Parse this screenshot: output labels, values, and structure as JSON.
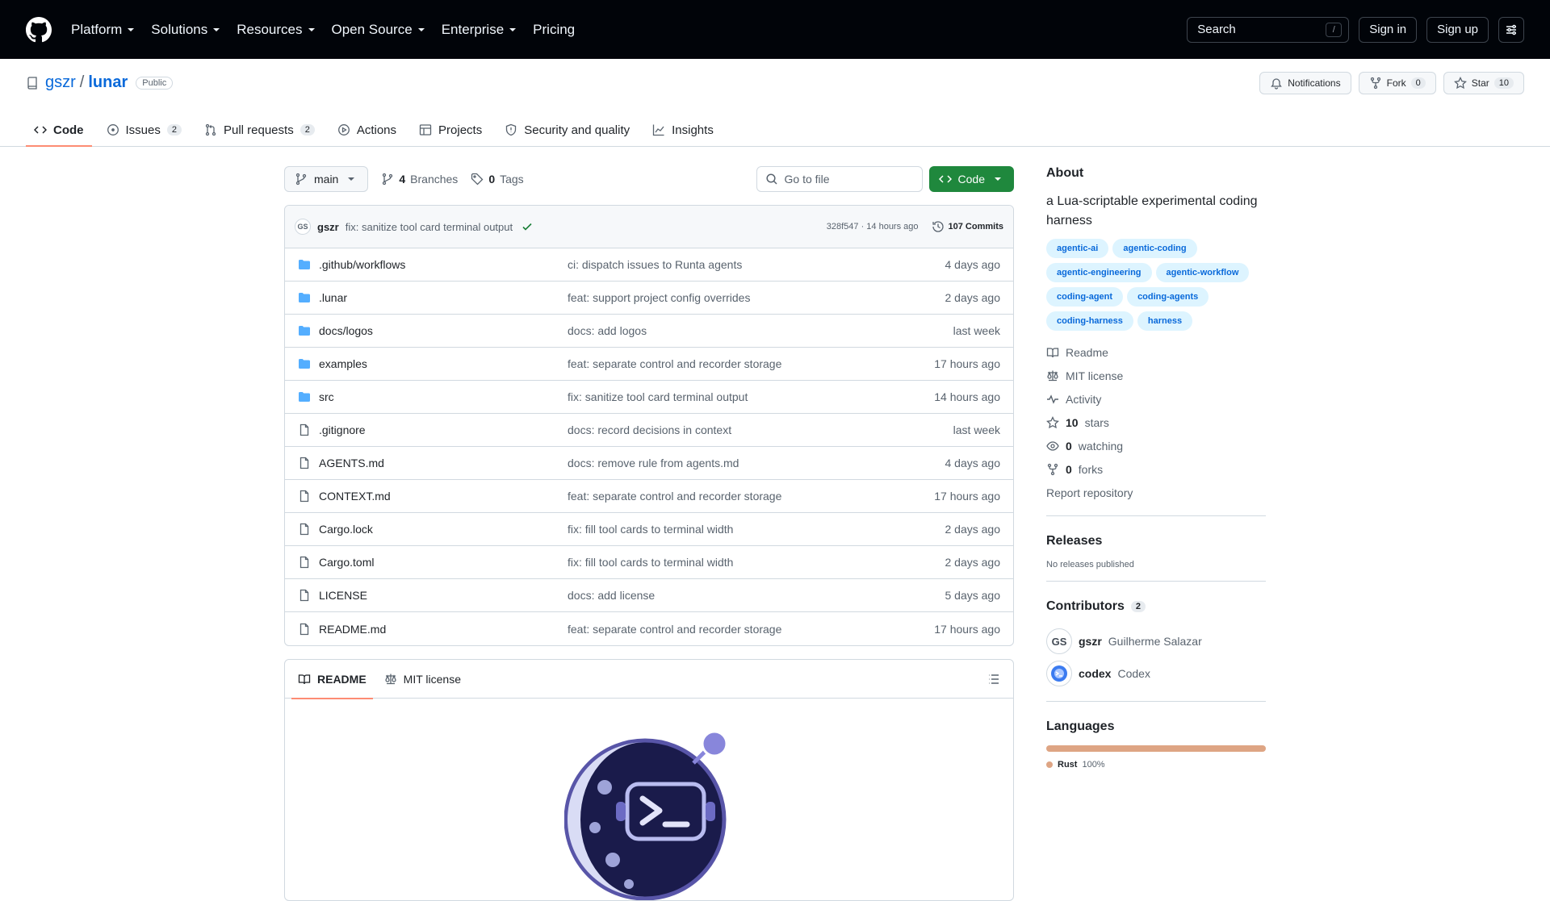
{
  "header": {
    "nav": [
      "Platform",
      "Solutions",
      "Resources",
      "Open Source",
      "Enterprise",
      "Pricing"
    ],
    "search_label": "Search",
    "search_key": "/",
    "signin": "Sign in",
    "signup": "Sign up"
  },
  "repo": {
    "owner": "gszr",
    "separator": "/",
    "name": "lunar",
    "visibility": "Public",
    "notifications": "Notifications",
    "fork_label": "Fork",
    "fork_count": "0",
    "star_label": "Star",
    "star_count": "10"
  },
  "tabs": [
    {
      "label": "Code"
    },
    {
      "label": "Issues",
      "count": "2"
    },
    {
      "label": "Pull requests",
      "count": "2"
    },
    {
      "label": "Actions"
    },
    {
      "label": "Projects"
    },
    {
      "label": "Security and quality"
    },
    {
      "label": "Insights"
    }
  ],
  "toolbar": {
    "branch": "main",
    "branches_count": "4",
    "branches_label": "Branches",
    "tags_count": "0",
    "tags_label": "Tags",
    "goto_placeholder": "Go to file",
    "code_btn": "Code"
  },
  "latest_commit": {
    "avatar_initials": "GS",
    "author": "gszr",
    "message": "fix: sanitize tool card terminal output",
    "sha_time": "328f547 · 14 hours ago",
    "commits": "107 Commits"
  },
  "files": [
    {
      "type": "dir",
      "name": ".github/workflows",
      "message": "ci: dispatch issues to Runta agents",
      "date": "4 days ago"
    },
    {
      "type": "dir",
      "name": ".lunar",
      "message": "feat: support project config overrides",
      "date": "2 days ago"
    },
    {
      "type": "dir",
      "name": "docs/logos",
      "message": "docs: add logos",
      "date": "last week"
    },
    {
      "type": "dir",
      "name": "examples",
      "message": "feat: separate control and recorder storage",
      "date": "17 hours ago"
    },
    {
      "type": "dir",
      "name": "src",
      "message": "fix: sanitize tool card terminal output",
      "date": "14 hours ago"
    },
    {
      "type": "file",
      "name": ".gitignore",
      "message": "docs: record decisions in context",
      "date": "last week"
    },
    {
      "type": "file",
      "name": "AGENTS.md",
      "message": "docs: remove rule from agents.md",
      "date": "4 days ago"
    },
    {
      "type": "file",
      "name": "CONTEXT.md",
      "message": "feat: separate control and recorder storage",
      "date": "17 hours ago"
    },
    {
      "type": "file",
      "name": "Cargo.lock",
      "message": "fix: fill tool cards to terminal width",
      "date": "2 days ago"
    },
    {
      "type": "file",
      "name": "Cargo.toml",
      "message": "fix: fill tool cards to terminal width",
      "date": "2 days ago"
    },
    {
      "type": "file",
      "name": "LICENSE",
      "message": "docs: add license",
      "date": "5 days ago"
    },
    {
      "type": "file",
      "name": "README.md",
      "message": "feat: separate control and recorder storage",
      "date": "17 hours ago"
    }
  ],
  "readme": {
    "tab_readme": "README",
    "tab_license": "MIT license"
  },
  "about": {
    "title": "About",
    "description": "a Lua-scriptable experimental coding harness",
    "topics": [
      "agentic-ai",
      "agentic-coding",
      "agentic-engineering",
      "agentic-workflow",
      "coding-agent",
      "coding-agents",
      "coding-harness",
      "harness"
    ],
    "readme": "Readme",
    "license": "MIT license",
    "activity": "Activity",
    "stars_count": "10",
    "stars_label": "stars",
    "watching_count": "0",
    "watching_label": "watching",
    "forks_count": "0",
    "forks_label": "forks",
    "report": "Report repository"
  },
  "releases": {
    "title": "Releases",
    "empty": "No releases published"
  },
  "contributors": {
    "title": "Contributors",
    "count": "2",
    "list": [
      {
        "avatar": "GS",
        "login": "gszr",
        "name": "Guilherme Salazar"
      },
      {
        "avatar": "",
        "login": "codex",
        "name": "Codex"
      }
    ]
  },
  "languages": {
    "title": "Languages",
    "items": [
      {
        "name": "Rust",
        "percent": "100%",
        "color": "#dea584"
      }
    ]
  },
  "colors": {
    "accent": "#0969da",
    "green": "#1f883d",
    "tab_underline": "#fd8c73",
    "folder": "#54aeff"
  }
}
